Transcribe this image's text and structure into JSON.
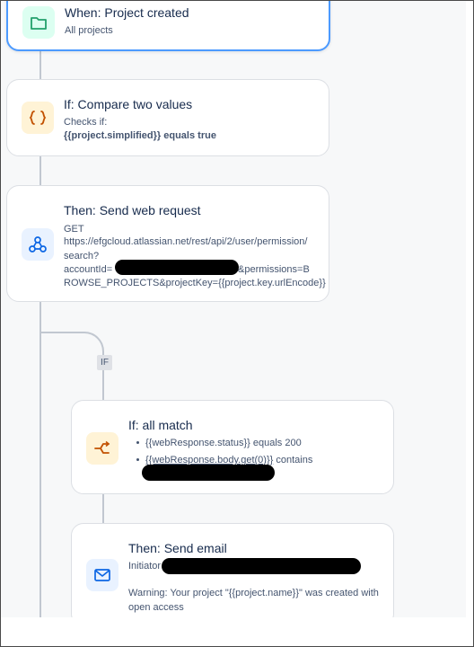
{
  "trigger": {
    "title": "When: Project created",
    "subtitle": "All projects",
    "icon": "folder-icon"
  },
  "condition": {
    "title": "If: Compare two values",
    "checks_label": "Checks if:",
    "expression": "{{project.simplified}} equals true",
    "icon": "curly-braces-icon"
  },
  "web_request": {
    "title": "Then: Send web request",
    "method": "GET",
    "url_line1": "https://efgcloud.atlassian.net/rest/api/2/user/permission/",
    "url_line2": "search?",
    "url_line3_prefix": "accountId=",
    "url_line3_suffix": "&permissions=B",
    "url_line4": "ROWSE_PROJECTS&projectKey={{project.key.urlEncode}}",
    "icon": "webhook-icon"
  },
  "branch": {
    "badge": "IF"
  },
  "all_match": {
    "title": "If: all match",
    "condition1": "{{webResponse.status}} equals 200",
    "condition2_prefix": "{{webResponse.body.get(0)}}",
    "condition2_suffix": " contains",
    "icon": "branch-icon"
  },
  "send_email": {
    "title": "Then: Send email",
    "recipient_label": "Initiator",
    "message": "Warning: Your project \"{{project.name}}\" was created with open access",
    "icon": "mail-icon"
  },
  "colors": {
    "accent_border": "#4c9aff",
    "trigger_icon_bg": "#dcfff1",
    "trigger_icon": "#22a06b",
    "condition_icon_bg": "#fff3d6",
    "condition_icon": "#c25100",
    "web_icon_bg": "#e9f2ff",
    "web_icon": "#0c66e4"
  }
}
